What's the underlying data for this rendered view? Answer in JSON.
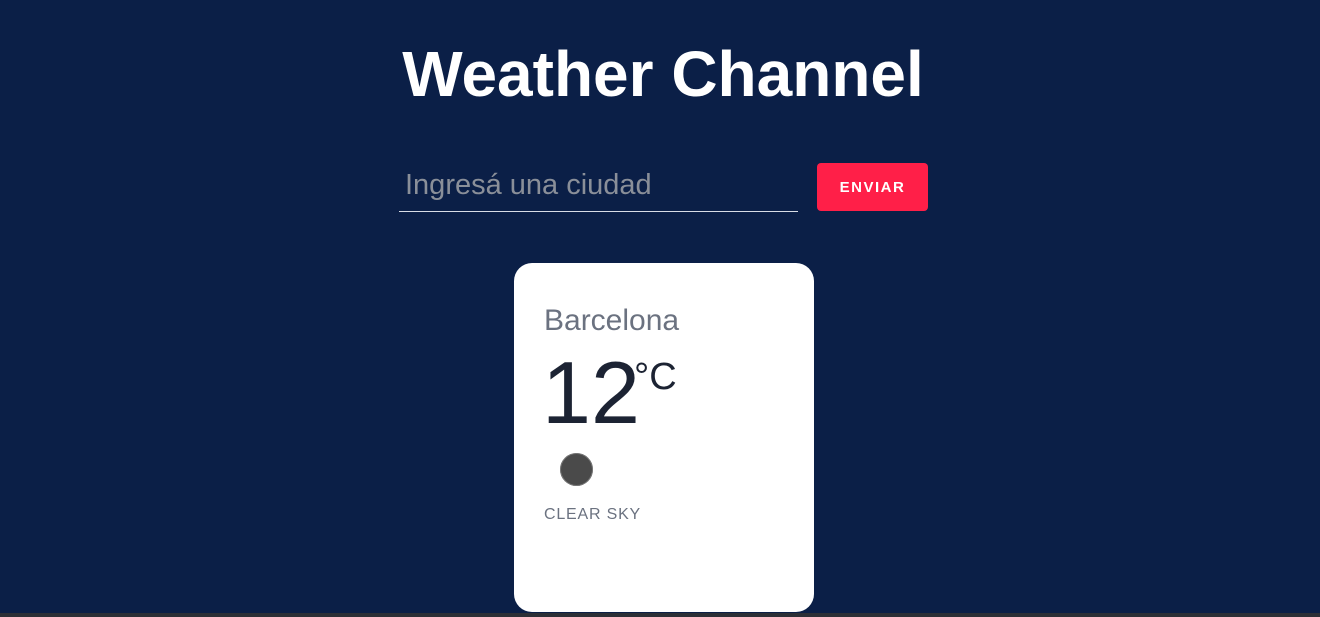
{
  "header": {
    "title": "Weather Channel"
  },
  "search": {
    "placeholder": "Ingresá una ciudad",
    "value": "",
    "button_label": "ENVIAR"
  },
  "weather_card": {
    "city": "Barcelona",
    "temperature": "12",
    "unit": "°C",
    "icon": "weather-icon",
    "condition": "CLEAR SKY"
  },
  "colors": {
    "background": "#0b1f47",
    "accent": "#ff1f48",
    "card": "#ffffff"
  }
}
